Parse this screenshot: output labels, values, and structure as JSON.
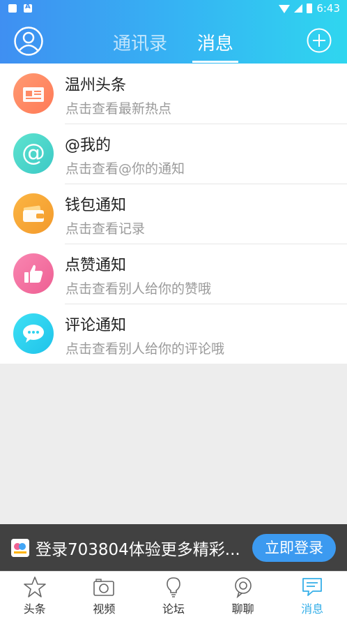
{
  "status_bar": {
    "time": "6:43"
  },
  "header": {
    "tabs": [
      {
        "label": "通讯录",
        "active": false
      },
      {
        "label": "消息",
        "active": true
      }
    ],
    "left_icon": "profile-icon",
    "right_icon": "plus-circle-icon"
  },
  "messages": [
    {
      "title": "温州头条",
      "subtitle": "点击查看最新热点",
      "icon": "newspaper-icon",
      "color": "#ff8a65"
    },
    {
      "title": "@我的",
      "subtitle": "点击查看@你的通知",
      "icon": "at-icon",
      "color": "#4dd8c8"
    },
    {
      "title": "钱包通知",
      "subtitle": "点击查看记录",
      "icon": "wallet-icon",
      "color": "#f7a739"
    },
    {
      "title": "点赞通知",
      "subtitle": "点击查看别人给你的赞哦",
      "icon": "thumbs-up-icon",
      "color": "#f56fa0"
    },
    {
      "title": "评论通知",
      "subtitle": "点击查看别人给你的评论哦",
      "icon": "comment-icon",
      "color": "#2ed3f0"
    }
  ],
  "banner": {
    "text": "登录703804体验更多精彩...",
    "button_label": "立即登录"
  },
  "tabbar": [
    {
      "label": "头条",
      "icon": "star-icon",
      "active": false
    },
    {
      "label": "视频",
      "icon": "camera-icon",
      "active": false
    },
    {
      "label": "论坛",
      "icon": "lightbulb-icon",
      "active": false
    },
    {
      "label": "聊聊",
      "icon": "chat-bubble-icon",
      "active": false
    },
    {
      "label": "消息",
      "icon": "message-icon",
      "active": true
    }
  ],
  "colors": {
    "header_start": "#3f8ff2",
    "header_end": "#2fd6ef",
    "accent": "#34aee8",
    "login_button": "#3c9af0"
  }
}
